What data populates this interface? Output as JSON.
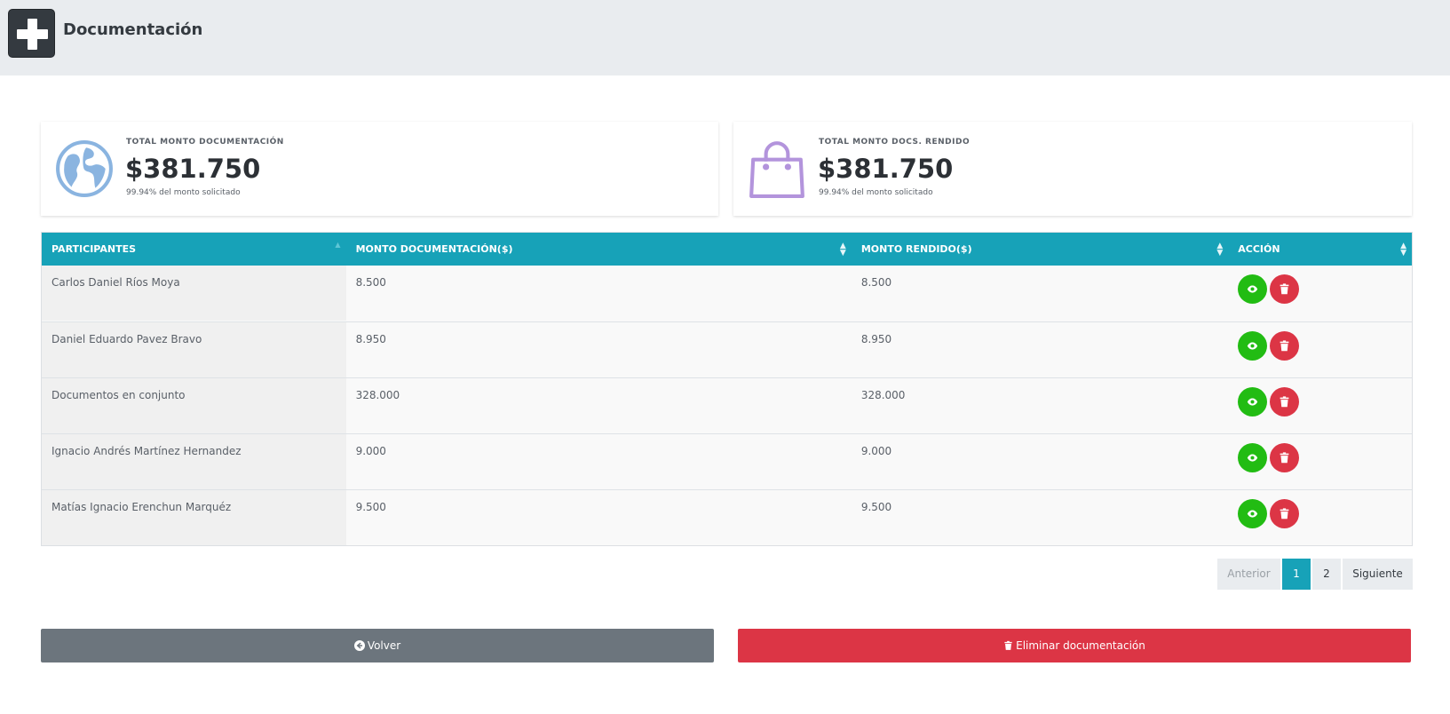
{
  "header": {
    "title": "Documentación",
    "logo_icon": "plus-icon"
  },
  "summary_cards": [
    {
      "label": "TOTAL MONTO DOCUMENTACIÓN",
      "amount": "$381.750",
      "subtext": "99.94% del monto solicitado",
      "icon": "globe-icon",
      "icon_color": "#8ab4e0"
    },
    {
      "label": "TOTAL MONTO DOCS. RENDIDO",
      "amount": "$381.750",
      "subtext": "99.94% del monto solicitado",
      "icon": "shopping-bag-icon",
      "icon_color": "#b394dc"
    }
  ],
  "table": {
    "headers": [
      "PARTICIPANTES",
      "MONTO DOCUMENTACIÓN($)",
      "MONTO RENDIDO($)",
      "ACCIÓN"
    ],
    "rows": [
      {
        "participant": "Carlos Daniel Ríos Moya",
        "monto_documentacion": "8.500",
        "monto_rendido": "8.500"
      },
      {
        "participant": "Daniel Eduardo Pavez Bravo",
        "monto_documentacion": "8.950",
        "monto_rendido": "8.950"
      },
      {
        "participant": "Documentos en conjunto",
        "monto_documentacion": "328.000",
        "monto_rendido": "328.000"
      },
      {
        "participant": "Ignacio Andrés Martínez Hernandez",
        "monto_documentacion": "9.000",
        "monto_rendido": "9.000"
      },
      {
        "participant": "Matías Ignacio Erenchun Marquéz",
        "monto_documentacion": "9.500",
        "monto_rendido": "9.500"
      }
    ],
    "row_actions": [
      "eye-icon",
      "trash-icon"
    ]
  },
  "pagination": {
    "prev": "Anterior",
    "pages": [
      "1",
      "2"
    ],
    "current": "1",
    "next": "Siguiente"
  },
  "actions": {
    "back_label": "Volver",
    "delete_label": "Eliminar documentación"
  },
  "colors": {
    "primary": "#17a2b8",
    "success": "#22bc13",
    "danger": "#dc3545",
    "secondary": "#6c757d",
    "header_bg": "#e9ecef"
  }
}
